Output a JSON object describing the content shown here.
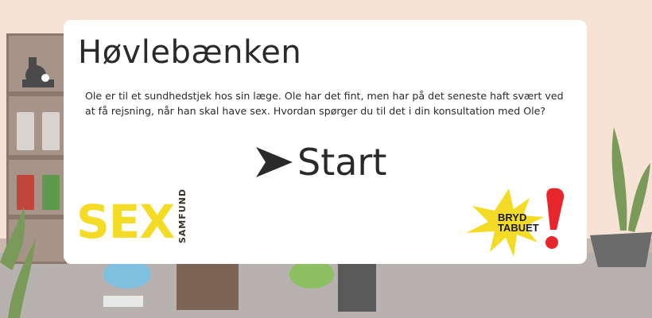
{
  "app": {
    "title": "Høvlebænken",
    "description": "Ole er til et sundhedstjek hos sin læge. Ole har det fint, men har på det seneste haft svært ved at få rejsning, når han skal have sex. Hvordan spørger du til det i din konsultation med Ole?",
    "start_label": "Start",
    "start_icon": "arrow-right-icon"
  },
  "logos": {
    "sex_main": "SEX",
    "sex_sub": "SAMFUND",
    "bryd_line1": "BRYD",
    "bryd_line2": "TABUET"
  },
  "colors": {
    "background_wall": "#f7e3d6",
    "floor": "#b7b2af",
    "card": "#ffffff",
    "sex_yellow": "#f4dc26",
    "bryd_red": "#e8262b"
  }
}
